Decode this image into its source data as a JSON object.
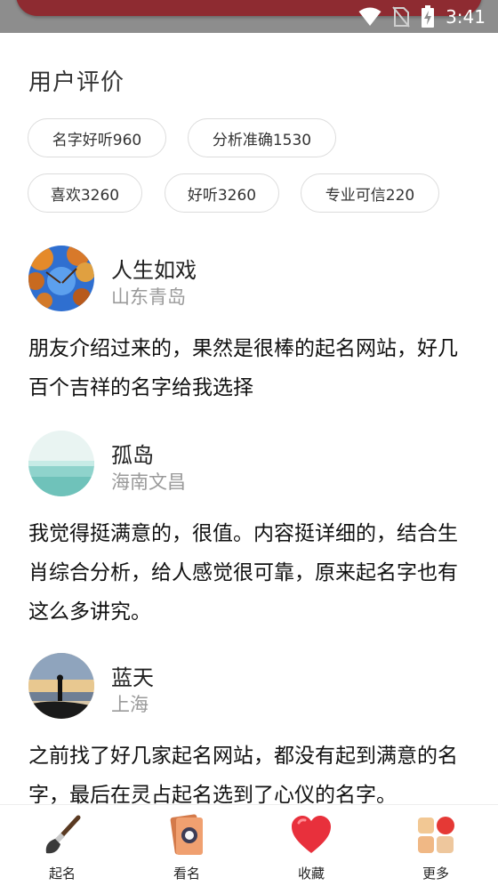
{
  "status_bar": {
    "time": "3:41"
  },
  "section": {
    "title": "用户评价"
  },
  "tags": [
    "名字好听960",
    "分析准确1530",
    "喜欢3260",
    "好听3260",
    "专业可信220"
  ],
  "reviews": [
    {
      "name": "人生如戏",
      "location": "山东青岛",
      "text": "朋友介绍过来的，果然是很棒的起名网站，好几百个吉祥的名字给我选择"
    },
    {
      "name": "孤岛",
      "location": "海南文昌",
      "text": "我觉得挺满意的，很值。内容挺详细的，结合生肖综合分析，给人感觉很可靠，原来起名字也有这么多讲究。"
    },
    {
      "name": "蓝天",
      "location": "上海",
      "text": "之前找了好几家起名网站，都没有起到满意的名字，最后在灵占起名选到了心仪的名字。"
    }
  ],
  "bottom_nav": [
    {
      "label": "起名",
      "icon": "brush-icon"
    },
    {
      "label": "看名",
      "icon": "name-card-icon"
    },
    {
      "label": "收藏",
      "icon": "heart-icon"
    },
    {
      "label": "更多",
      "icon": "grid-icon"
    }
  ]
}
